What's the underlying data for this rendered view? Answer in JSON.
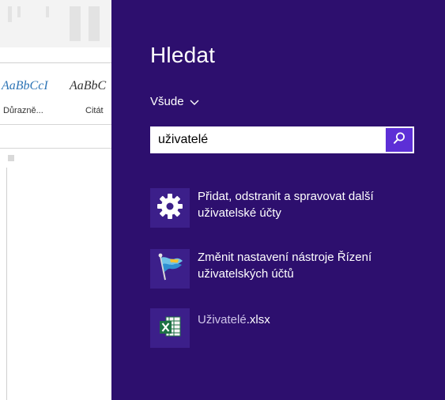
{
  "background_app": {
    "styles": [
      {
        "preview": "AaBbCcI",
        "name": "Důrazně..."
      },
      {
        "preview": "AaBbC",
        "name": "Citát"
      }
    ]
  },
  "charm": {
    "title": "Hledat",
    "scope_label": "Všude",
    "search": {
      "value": "uživatelé",
      "placeholder": ""
    },
    "results": [
      {
        "icon": "gear-icon",
        "text": "Přidat, odstranit a spravovat další uživatelské účty"
      },
      {
        "icon": "uac-flag-icon",
        "text": "Změnit nastavení nástroje Řízení uživatelských účtů"
      },
      {
        "icon": "excel-file-icon",
        "name": "Uživatelé",
        "ext": ".xlsx"
      }
    ]
  },
  "colors": {
    "charm_background": "#2d0f6e",
    "search_button": "#5d2fd6",
    "tile_background": "#3c1f8a"
  }
}
